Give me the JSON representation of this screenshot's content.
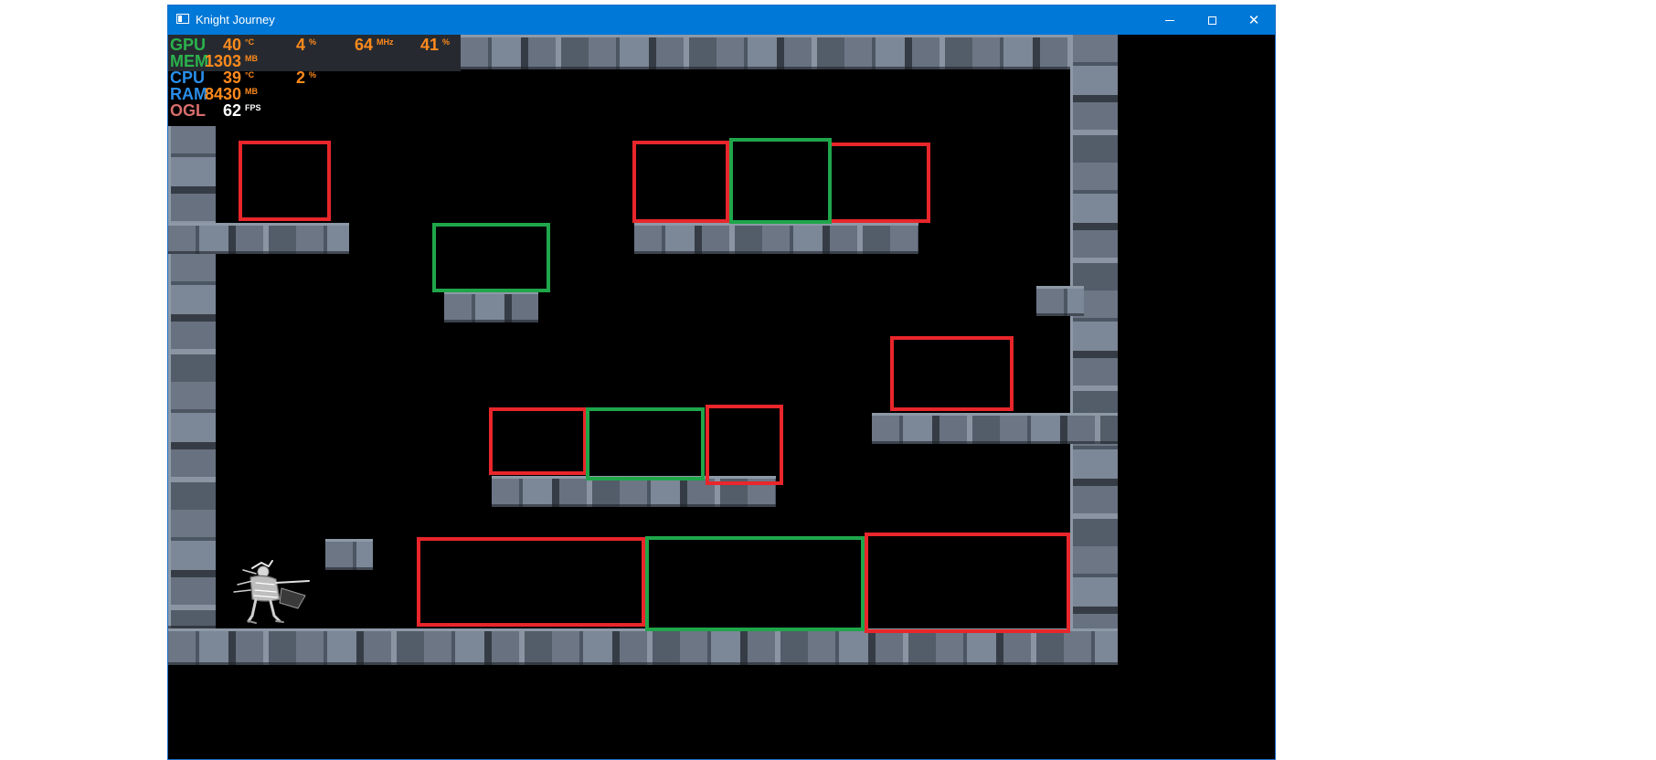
{
  "window": {
    "title": "Knight Journey",
    "controls": {
      "minimize": "—",
      "maximize": "□",
      "close": "✕"
    }
  },
  "overlay": {
    "rows": [
      {
        "label": "GPU",
        "cells": [
          {
            "value": "40",
            "unit": "°C"
          },
          {
            "value": "4",
            "unit": "%"
          },
          {
            "value": "64",
            "unit": "MHz"
          },
          {
            "value": "41",
            "unit": "%"
          }
        ]
      },
      {
        "label": "MEM",
        "cells": [
          {
            "value": "1303",
            "unit": "MB"
          }
        ]
      },
      {
        "label": "CPU",
        "cells": [
          {
            "value": "39",
            "unit": "°C"
          },
          {
            "value": "2",
            "unit": "%"
          }
        ]
      },
      {
        "label": "RAM",
        "cells": [
          {
            "value": "8430",
            "unit": "MB"
          }
        ]
      },
      {
        "label": "OGL",
        "cells": [
          {
            "value": "62",
            "unit": "FPS"
          }
        ]
      }
    ]
  },
  "scene": {
    "colors": {
      "background": "#000000",
      "stone": "#5d6775",
      "red_box": "#e8262b",
      "green_box": "#1fa64a"
    }
  }
}
